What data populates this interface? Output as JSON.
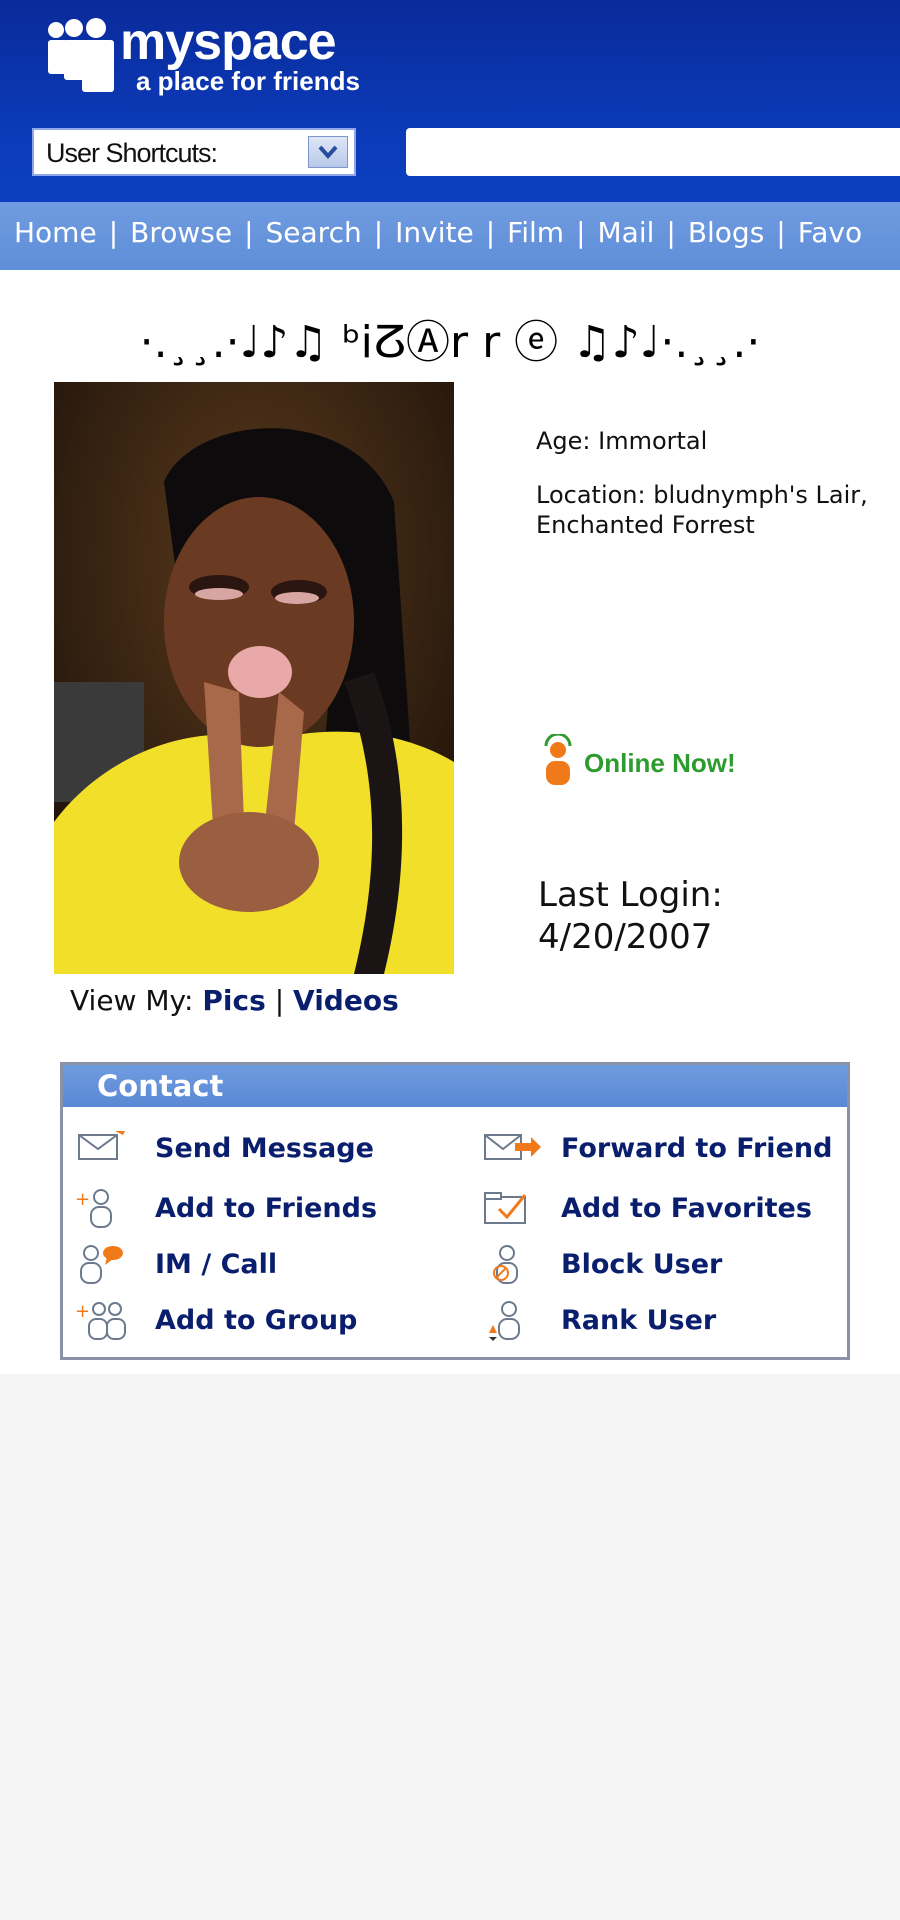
{
  "header": {
    "logo_word": "myspace",
    "logo_tagline": "a place for friends",
    "shortcuts_label": "User Shortcuts:",
    "search_value": ""
  },
  "nav": {
    "items": [
      "Home",
      "Browse",
      "Search",
      "Invite",
      "Film",
      "Mail",
      "Blogs",
      "Favo"
    ]
  },
  "profile": {
    "display_name": "·.¸¸.·♩♪♫ ᵇiⵒⒶr r ⓔ ♫♪♩·.¸¸.·",
    "age": "Age: Immortal",
    "location_line1": "Location: bludnymph's Lair,",
    "location_line2": "Enchanted Forrest",
    "online_status": "Online Now!",
    "last_login_label": "Last Login:",
    "last_login_date": "4/20/2007",
    "view_my_label": "View My:",
    "view_pics": "Pics",
    "view_sep": "|",
    "view_videos": "Videos"
  },
  "contact": {
    "title": "Contact",
    "items": [
      {
        "label": "Send Message",
        "icon": "envelope-icon"
      },
      {
        "label": "Forward to Friend",
        "icon": "forward-envelope-icon"
      },
      {
        "label": "Add to Friends",
        "icon": "add-friend-icon"
      },
      {
        "label": "Add to Favorites",
        "icon": "favorites-folder-icon"
      },
      {
        "label": "IM / Call",
        "icon": "im-call-icon"
      },
      {
        "label": "Block User",
        "icon": "block-user-icon"
      },
      {
        "label": "Add to Group",
        "icon": "add-group-icon"
      },
      {
        "label": "Rank User",
        "icon": "rank-user-icon"
      }
    ]
  },
  "colors": {
    "header_blue": "#0b3ab6",
    "nav_blue": "#6f9be0",
    "link_navy": "#0a1e6e",
    "online_green": "#2e9b2e",
    "online_orange": "#f07a1a"
  }
}
